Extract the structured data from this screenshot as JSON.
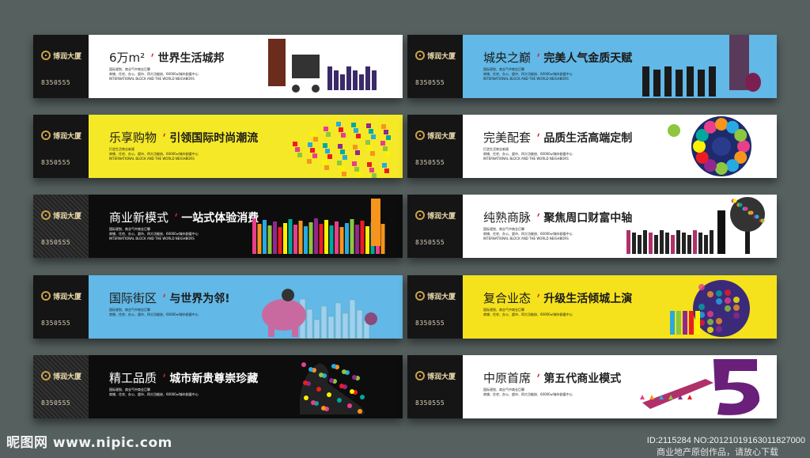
{
  "boards": [
    {
      "id": "b1",
      "bg": "#ffffff",
      "text": "#222222",
      "headline": "6万m²",
      "subtitle": "世界生活城邦",
      "desc1": "国际规划、商业气中商业巨擘",
      "desc2": "商铺、住宅、办公、超市、四大功能核、60000㎡城市剧量中心",
      "desc3": "INTERNATIONAL BLOCK AND THE WORLD NEIGHBORS",
      "art": "shoppers-silhouettes"
    },
    {
      "id": "b2",
      "bg": "#62b8e6",
      "text": "#1a1a1a",
      "headline": "城央之巅",
      "subtitle": "完美人气金质天赋",
      "desc1": "国际规划、商业气中商业巨擘",
      "desc2": "商铺、住宅、办公、超市、四大功能核、60000㎡城市剧量中心",
      "desc3": "INTERNATIONAL BLOCK AND THE WORLD NEIGHBORS",
      "art": "crowd-silhouettes"
    },
    {
      "id": "b3",
      "bg": "#f5e927",
      "text": "#1a1a1a",
      "headline": "乐享购物",
      "subtitle": "引领国际时尚潮流",
      "desc1": "打造生活商业新规",
      "desc2": "商铺、住宅、办公、超市、四大功能核、60000㎡城市剧量中心",
      "desc3": "INTERNATIONAL BLOCK AND THE WORLD NEIGHBORS",
      "art": "arrow-of-products"
    },
    {
      "id": "b4",
      "bg": "#ffffff",
      "text": "#222222",
      "headline": "完美配套",
      "subtitle": "品质生活高端定制",
      "desc1": "打造生活商业新规",
      "desc2": "商铺、住宅、办公、超市、四大功能核、60000㎡城市剧量中心",
      "desc3": "INTERNATIONAL BLOCK AND THE WORLD NEIGHBORS",
      "art": "lifestyle-wheel"
    },
    {
      "id": "b5",
      "bg": "#0d0d0d",
      "text": "#ffffff",
      "headline": "商业新模式",
      "subtitle": "一站式体验消费",
      "desc1": "国际规划、商业气中商业巨擘",
      "desc2": "商铺、住宅、办公、超市、四大功能核、60000㎡城市剧量中心",
      "desc3": "INTERNATIONAL BLOCK AND THE WORLD NEIGHBORS",
      "art": "colorful-crowd"
    },
    {
      "id": "b6",
      "bg": "#ffffff",
      "text": "#222222",
      "headline": "纯熟商脉",
      "subtitle": "聚焦周口财富中轴",
      "desc1": "国际规划、商业气中商业巨擘",
      "desc2": "商铺、住宅、办公、超市、四大功能核、60000㎡城市剧量中心",
      "desc3": "INTERNATIONAL BLOCK AND THE WORLD NEIGHBORS",
      "art": "crowd-and-tree"
    },
    {
      "id": "b7",
      "bg": "#62b8e6",
      "text": "#1a1a1a",
      "headline": "国际街区",
      "subtitle": "与世界为邻!",
      "desc1": "国际规划、商业气中商业巨擘",
      "desc2": "商铺、住宅、办公、超市、四大功能核、60000㎡城市剧量中心",
      "desc3": "",
      "art": "elephant-skyline"
    },
    {
      "id": "b8",
      "bg": "#f5e21c",
      "text": "#1a1a1a",
      "headline": "复合业态",
      "subtitle": "升级生活倾城上演",
      "desc1": "国际规划、商业气中商业巨擘",
      "desc2": "商铺、住宅、办公、超市、四大功能核、60000㎡城市剧量中心",
      "desc3": "",
      "art": "purple-globe"
    },
    {
      "id": "b9",
      "bg": "#0d0d0d",
      "text": "#ffffff",
      "headline": "精工品质",
      "subtitle": "城市新贵尊崇珍藏",
      "desc1": "国际规划、商业气中商业巨擘",
      "desc2": "商铺、住宅、办公、超市、四大功能核、60000㎡城市剧量中心",
      "desc3": "",
      "art": "floral-heel"
    },
    {
      "id": "b10",
      "bg": "#ffffff",
      "text": "#222222",
      "headline": "中原首席",
      "subtitle": "第五代商业模式",
      "desc1": "国际规划、商业气中商业巨擘",
      "desc2": "商铺、住宅、办公、超市、四大功能核、60000㎡城市剧量中心",
      "desc3": "",
      "art": "purple-number-five"
    }
  ],
  "logo": {
    "name": "博润大厦",
    "phone": "8350555"
  },
  "footer": {
    "site": "昵图网 www.nipic.com",
    "id": "ID:2115284 NO:20121019163011827000",
    "promo": "商业地产原创作品，请放心下载"
  }
}
